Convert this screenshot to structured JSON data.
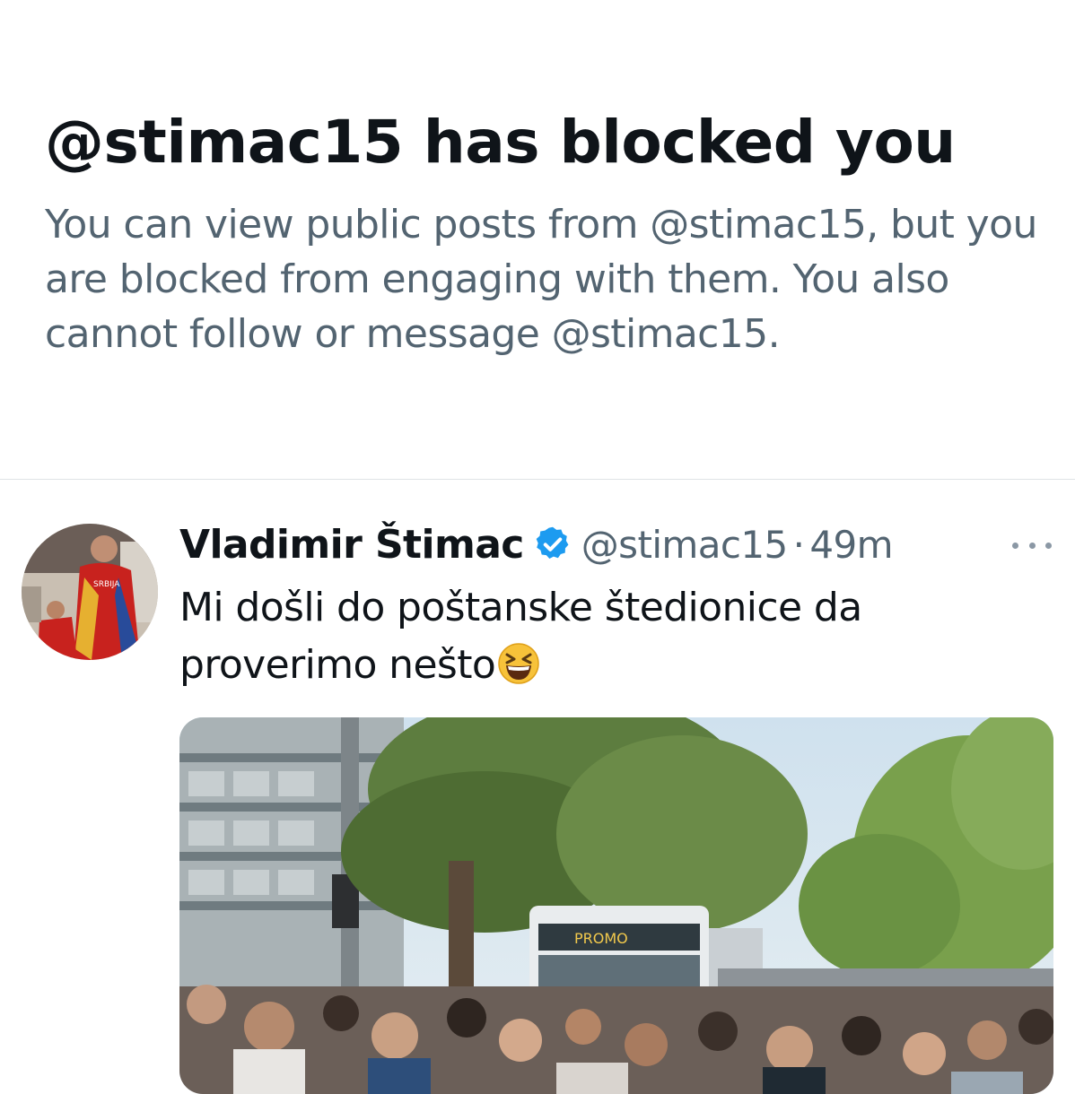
{
  "blocked_notice": {
    "title": "@stimac15 has blocked you",
    "description": "You can view public posts from @stimac15, but you are blocked from engaging with them. You also cannot follow or message @stimac15."
  },
  "post": {
    "author_name": "Vladimir Štimac",
    "handle": "@stimac15",
    "separator": "·",
    "time": "49m",
    "text": "Mi došli do poštanske štedionice da proverimo nešto",
    "emoji": "grinning-squinting-face-icon",
    "avatar_jersey_text": "SRBIJA",
    "media_bus_sign": "PROMO"
  },
  "colors": {
    "text_primary": "#0f1419",
    "text_secondary": "#536471",
    "verified_blue": "#1d9bf0",
    "divider": "#dfe3e6"
  }
}
